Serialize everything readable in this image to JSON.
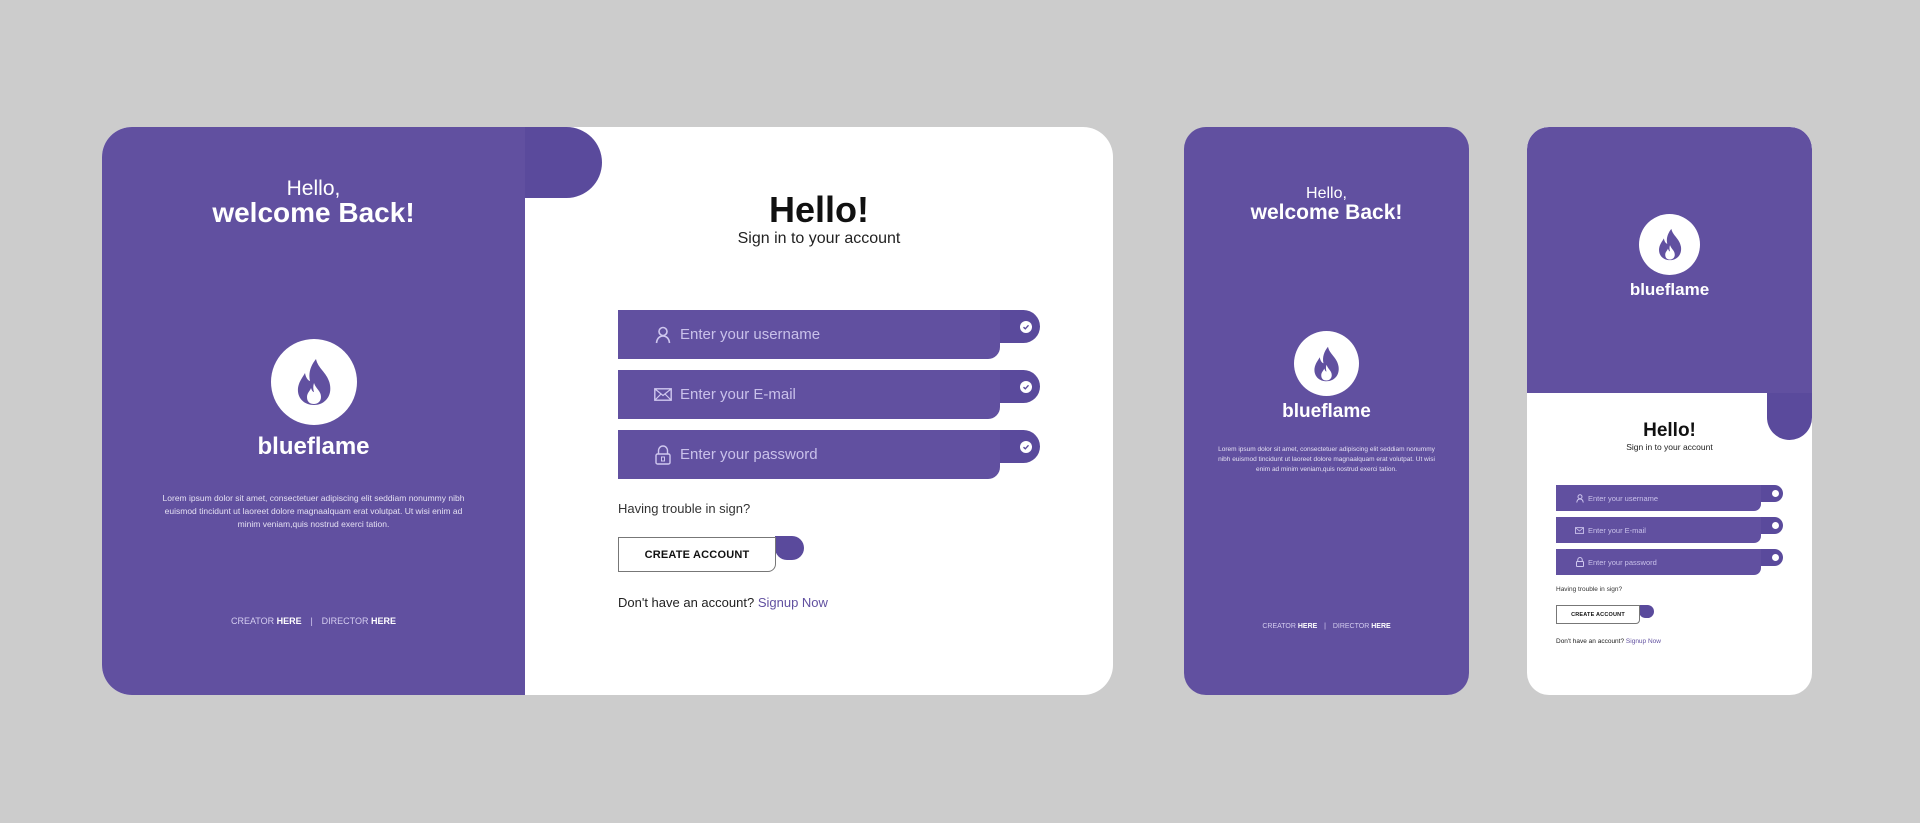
{
  "colors": {
    "background": "#cccccc",
    "brand_purple": "#6150a0",
    "brand_purple_dark": "#5a4a9c",
    "card_white": "#ffffff"
  },
  "welcome": {
    "greeting": "Hello,",
    "headline": "welcome Back!"
  },
  "brand": {
    "name": "blueflame",
    "icon": "flame-icon"
  },
  "description": "Lorem ipsum dolor sit amet, consectetuer adipiscing elit seddiam nonummy nibh euismod tincidunt ut laoreet dolore magnaalquam erat volutpat. Ut wisi enim ad minim veniam,quis nostrud exerci tation.",
  "credits": {
    "creator_label": "CREATOR",
    "creator_link": "HERE",
    "separator": "|",
    "director_label": "DIRECTOR",
    "director_link": "HERE"
  },
  "signin": {
    "title": "Hello!",
    "subtitle": "Sign in to your account",
    "fields": [
      {
        "icon": "user-icon",
        "placeholder": "Enter your username",
        "value": "",
        "status_icon": "check-circle-icon"
      },
      {
        "icon": "envelope-icon",
        "placeholder": "Enter your E-mail",
        "value": "",
        "status_icon": "check-circle-icon"
      },
      {
        "icon": "lock-icon",
        "placeholder": "Enter your password",
        "value": "",
        "status_icon": "check-circle-icon"
      }
    ],
    "trouble_text": "Having trouble in sign?",
    "create_account_label": "CREATE ACCOUNT",
    "no_account_text": "Don't have an account?",
    "signup_link": "Signup Now"
  }
}
